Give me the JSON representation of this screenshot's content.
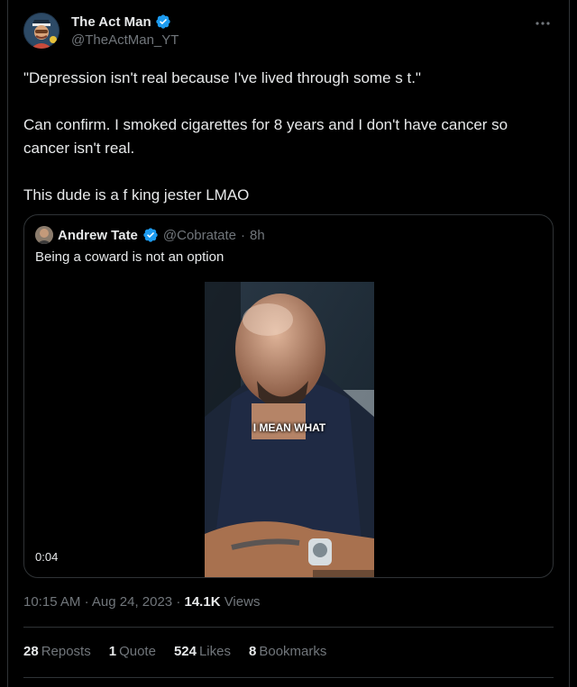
{
  "author": {
    "display_name": "The Act Man",
    "handle": "@TheActMan_YT",
    "verified": true
  },
  "tweet": {
    "paragraphs": [
      "\"Depression isn't real because I've lived through some s    t.\"",
      "Can confirm. I smoked cigarettes for 8 years and I don't have cancer so cancer isn't real.",
      "This dude is a f     king jester LMAO"
    ]
  },
  "quoted_tweet": {
    "display_name": "Andrew Tate",
    "handle": "@Cobratate",
    "separator": "·",
    "time_ago": "8h",
    "text": "Being a coward is not an option",
    "video_caption": "I MEAN WHAT",
    "video_duration": "0:04"
  },
  "meta": {
    "time": "10:15 AM",
    "date": "Aug 24, 2023",
    "separator": "·",
    "views_count": "14.1K",
    "views_label": "Views"
  },
  "stats": {
    "reposts_count": "28",
    "reposts_label": "Reposts",
    "quotes_count": "1",
    "quotes_label": "Quote",
    "likes_count": "524",
    "likes_label": "Likes",
    "bookmarks_count": "8",
    "bookmarks_label": "Bookmarks"
  },
  "colors": {
    "background": "#000000",
    "text_primary": "#e7e9ea",
    "text_secondary": "#71767b",
    "border": "#2f3336",
    "verified_blue": "#1d9bf0"
  },
  "icons": {
    "more": "more-icon",
    "verified": "verified-badge-icon"
  }
}
